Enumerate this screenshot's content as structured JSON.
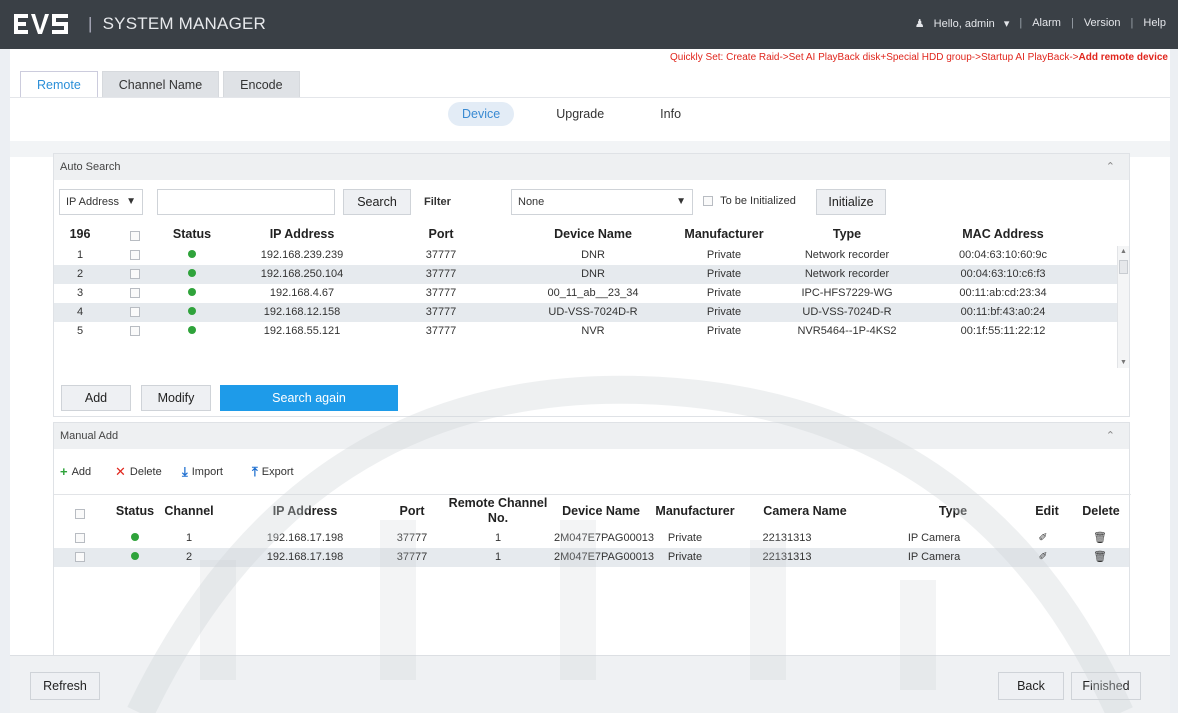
{
  "header": {
    "logo_text": "EVS",
    "title": "SYSTEM MANAGER",
    "user": "Hello, admin",
    "alarm": "Alarm",
    "version": "Version",
    "help": "Help"
  },
  "quickset": {
    "prefix": "Quickly Set: Create Raid->Set AI PlayBack disk+Special HDD group->Startup AI PlayBack->",
    "highlight": "Add remote device"
  },
  "tabs": [
    "Remote",
    "Channel Name",
    "Encode"
  ],
  "subtabs": [
    "Device",
    "Upgrade",
    "Info"
  ],
  "auto_search": {
    "title": "Auto Search",
    "search_type": "IP Address",
    "search_value": "",
    "search_btn": "Search",
    "filter_label": "Filter",
    "filter_value": "None",
    "to_init_label": "To be Initialized",
    "initialize_btn": "Initialize",
    "count": "196",
    "columns": [
      "Status",
      "IP Address",
      "Port",
      "Device Name",
      "Manufacturer",
      "Type",
      "MAC Address"
    ],
    "rows": [
      {
        "no": "1",
        "ip": "192.168.239.239",
        "port": "37777",
        "name": "DNR",
        "manu": "Private",
        "type": "Network recorder",
        "mac": "00:04:63:10:60:9c"
      },
      {
        "no": "2",
        "ip": "192.168.250.104",
        "port": "37777",
        "name": "DNR",
        "manu": "Private",
        "type": "Network recorder",
        "mac": "00:04:63:10:c6:f3"
      },
      {
        "no": "3",
        "ip": "192.168.4.67",
        "port": "37777",
        "name": "00_11_ab__23_34",
        "manu": "Private",
        "type": "IPC-HFS7229-WG",
        "mac": "00:11:ab:cd:23:34"
      },
      {
        "no": "4",
        "ip": "192.168.12.158",
        "port": "37777",
        "name": "UD-VSS-7024D-R",
        "manu": "Private",
        "type": "UD-VSS-7024D-R",
        "mac": "00:11:bf:43:a0:24"
      },
      {
        "no": "5",
        "ip": "192.168.55.121",
        "port": "37777",
        "name": "NVR",
        "manu": "Private",
        "type": "NVR5464--1P-4KS2",
        "mac": "00:1f:55:11:22:12"
      }
    ],
    "add_btn": "Add",
    "modify_btn": "Modify",
    "search_again_btn": "Search again"
  },
  "manual_add": {
    "title": "Manual Add",
    "add": "Add",
    "delete": "Delete",
    "import": "Import",
    "export": "Export",
    "columns": {
      "status": "Status",
      "channel": "Channel",
      "ip": "IP Address",
      "port": "Port",
      "remote_channel": "Remote Channel No.",
      "device_name": "Device Name",
      "manufacturer": "Manufacturer",
      "camera_name": "Camera Name",
      "type": "Type",
      "edit": "Edit",
      "delete": "Delete"
    },
    "rows": [
      {
        "channel": "1",
        "ip": "192.168.17.198",
        "port": "37777",
        "remote": "1",
        "name": "2M047E7PAG00013",
        "manu": "Private",
        "camera": "22131313",
        "type": "IP Camera"
      },
      {
        "channel": "2",
        "ip": "192.168.17.198",
        "port": "37777",
        "remote": "1",
        "name": "2M047E7PAG00013",
        "manu": "Private",
        "camera": "22131313",
        "type": "IP Camera"
      }
    ]
  },
  "footer": {
    "refresh": "Refresh",
    "back": "Back",
    "finished": "Finished"
  },
  "colors": {
    "accent": "#1e9be9",
    "status_online": "#2fa33b",
    "quickset_red": "#e0261d",
    "topbar": "#3a4046"
  }
}
